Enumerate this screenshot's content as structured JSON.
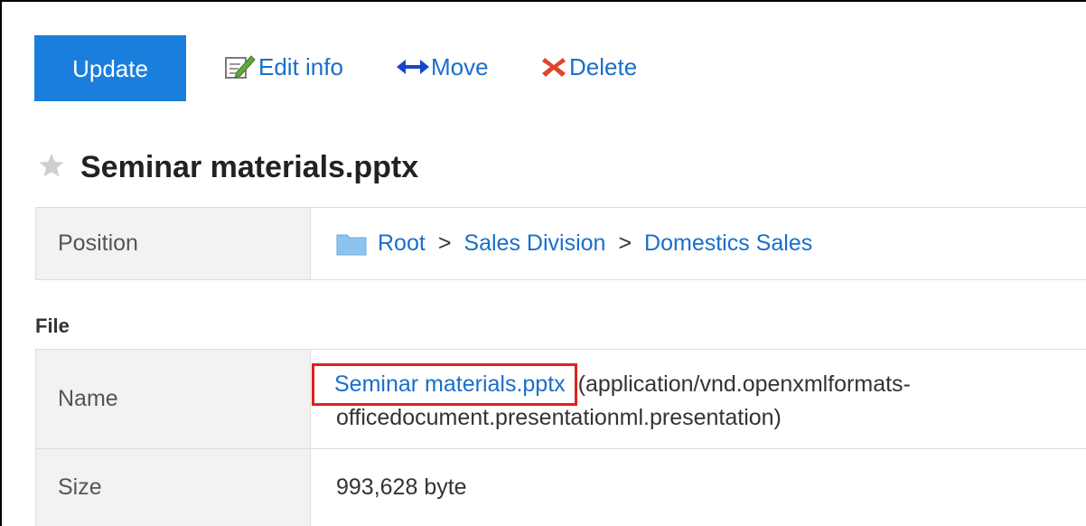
{
  "toolbar": {
    "update_label": "Update",
    "edit_label": "Edit info",
    "move_label": "Move",
    "delete_label": "Delete"
  },
  "title": "Seminar materials.pptx",
  "position": {
    "label": "Position",
    "breadcrumb": [
      "Root",
      "Sales Division",
      "Domestics Sales"
    ],
    "separator": ">"
  },
  "file_section": {
    "heading": "File",
    "name_label": "Name",
    "file_name": "Seminar materials.pptx",
    "mime_line1": "(application/vnd.openxmlformats-",
    "mime_line2": "officedocument.presentationml.presentation)",
    "size_label": "Size",
    "size_value": "993,628 byte"
  },
  "colors": {
    "accent": "#1a7fdc",
    "link": "#1a6fc9",
    "highlight": "#e02020",
    "label_bg": "#f2f2f2"
  },
  "icons": [
    "edit-icon",
    "move-arrows-icon",
    "delete-x-icon",
    "star-icon",
    "folder-icon"
  ]
}
